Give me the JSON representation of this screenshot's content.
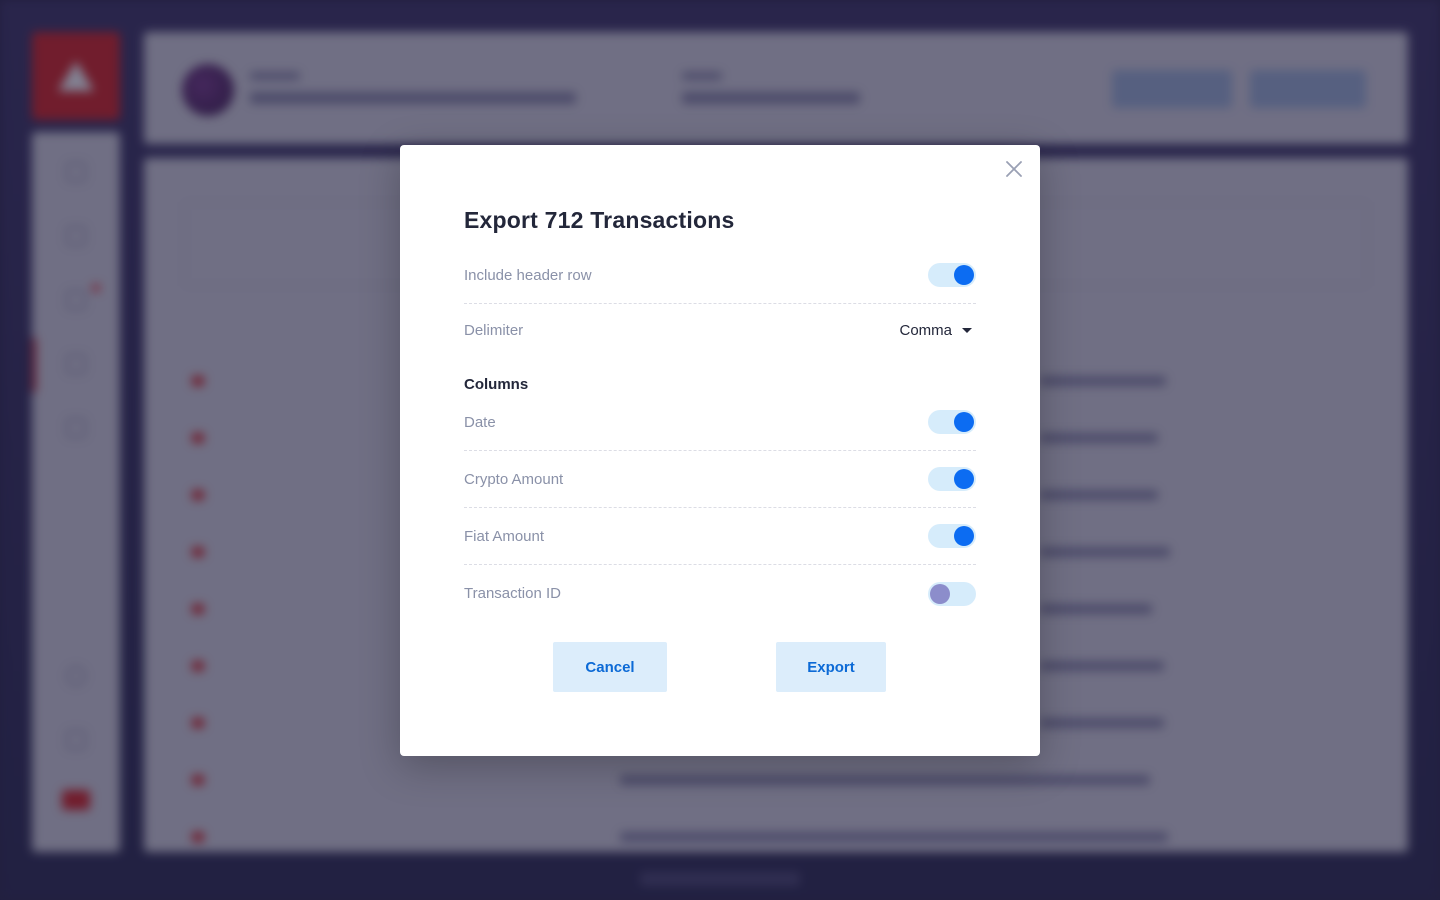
{
  "modal": {
    "title": "Export 712 Transactions",
    "close_icon": "close-icon",
    "options": {
      "header_row": {
        "label": "Include header row",
        "enabled": true
      },
      "delimiter": {
        "label": "Delimiter",
        "value": "Comma"
      }
    },
    "columns_heading": "Columns",
    "columns": [
      {
        "label": "Date",
        "enabled": true
      },
      {
        "label": "Crypto Amount",
        "enabled": true
      },
      {
        "label": "Fiat Amount",
        "enabled": true
      },
      {
        "label": "Transaction ID",
        "enabled": false
      }
    ],
    "buttons": {
      "cancel": "Cancel",
      "export": "Export"
    }
  },
  "colors": {
    "accent": "#0c6cf2",
    "toggle_track": "#d6ecfb",
    "toggle_off_knob": "#8c8dcb",
    "brand_red": "#d9221f",
    "button_bg": "#dcedfb",
    "button_text": "#0c6ad6"
  }
}
